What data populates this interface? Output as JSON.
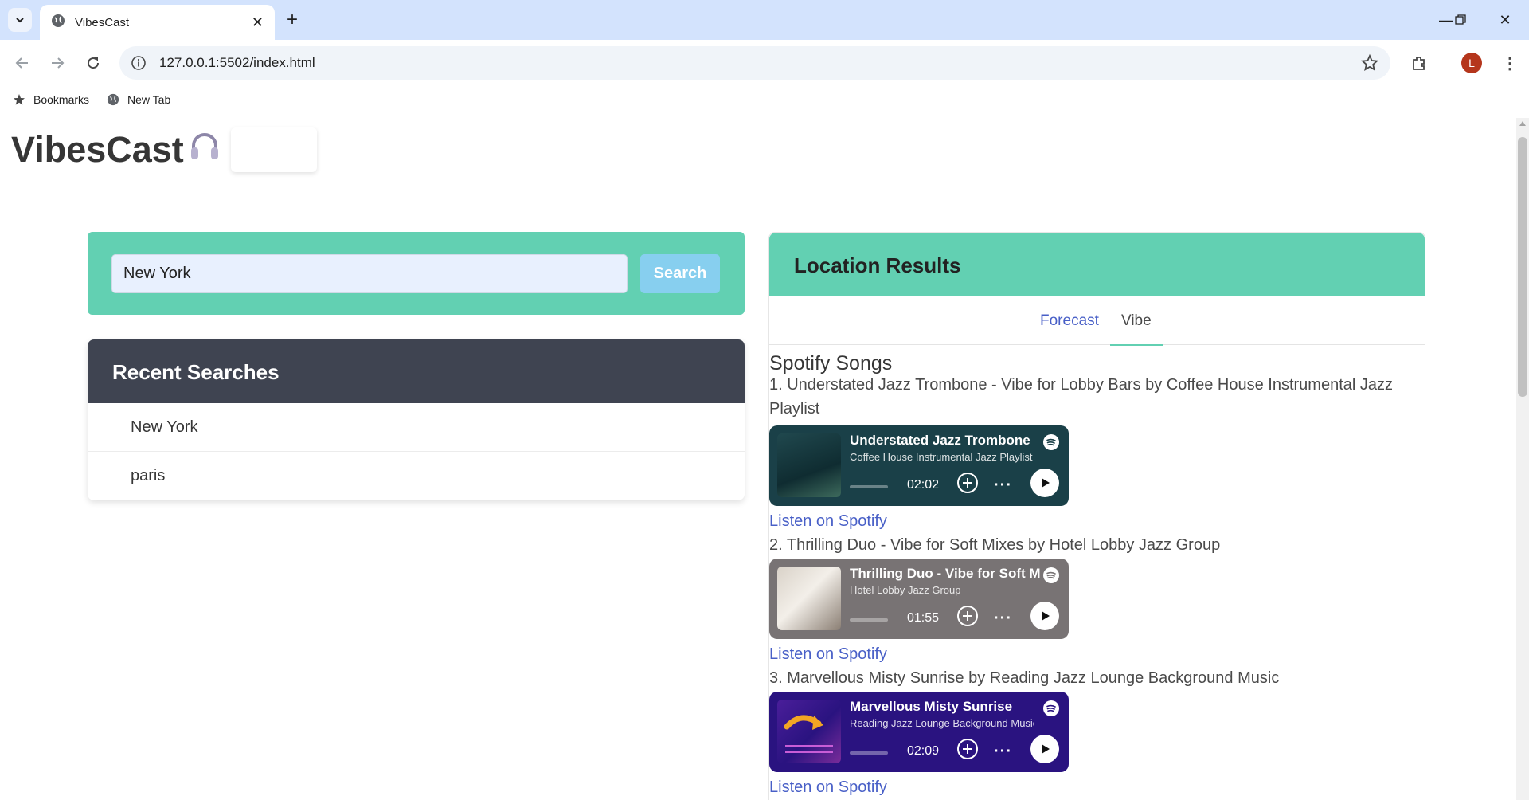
{
  "browser": {
    "tab_title": "VibesCast",
    "url": "127.0.0.1:5502/index.html",
    "profile_initial": "L",
    "bookmarks": [
      "Bookmarks",
      "New Tab"
    ]
  },
  "app": {
    "brand": "VibesCast",
    "search": {
      "value": "New York",
      "button": "Search"
    },
    "recent": {
      "title": "Recent Searches",
      "items": [
        "New York",
        "paris"
      ]
    },
    "results": {
      "title": "Location Results",
      "tabs": [
        "Forecast",
        "Vibe"
      ],
      "active_tab": "Vibe",
      "section_title": "Spotify Songs",
      "songs": [
        {
          "line": "1. Understated Jazz Trombone - Vibe for Lobby Bars by Coffee House Instrumental Jazz Playlist",
          "player_title": "Understated Jazz Trombone",
          "player_artist": "Coffee House Instrumental Jazz Playlist",
          "time": "02:02",
          "bg": "#1a4048",
          "link": "Listen on Spotify"
        },
        {
          "line": "2. Thrilling Duo - Vibe for Soft Mixes by Hotel Lobby Jazz Group",
          "player_title": "Thrilling Duo - Vibe for Soft Mixes",
          "player_artist": "Hotel Lobby Jazz Group",
          "time": "01:55",
          "bg": "#787374",
          "link": "Listen on Spotify"
        },
        {
          "line": "3. Marvellous Misty Sunrise by Reading Jazz Lounge Background Music",
          "player_title": "Marvellous Misty Sunrise",
          "player_artist": "Reading Jazz Lounge Background Music",
          "time": "02:09",
          "bg": "#2a1380",
          "link": "Listen on Spotify"
        }
      ]
    }
  },
  "colors": {
    "accent": "#62d0b2",
    "dark_header": "#3f4451",
    "link": "#485fc7",
    "search_button": "#87cfef"
  }
}
